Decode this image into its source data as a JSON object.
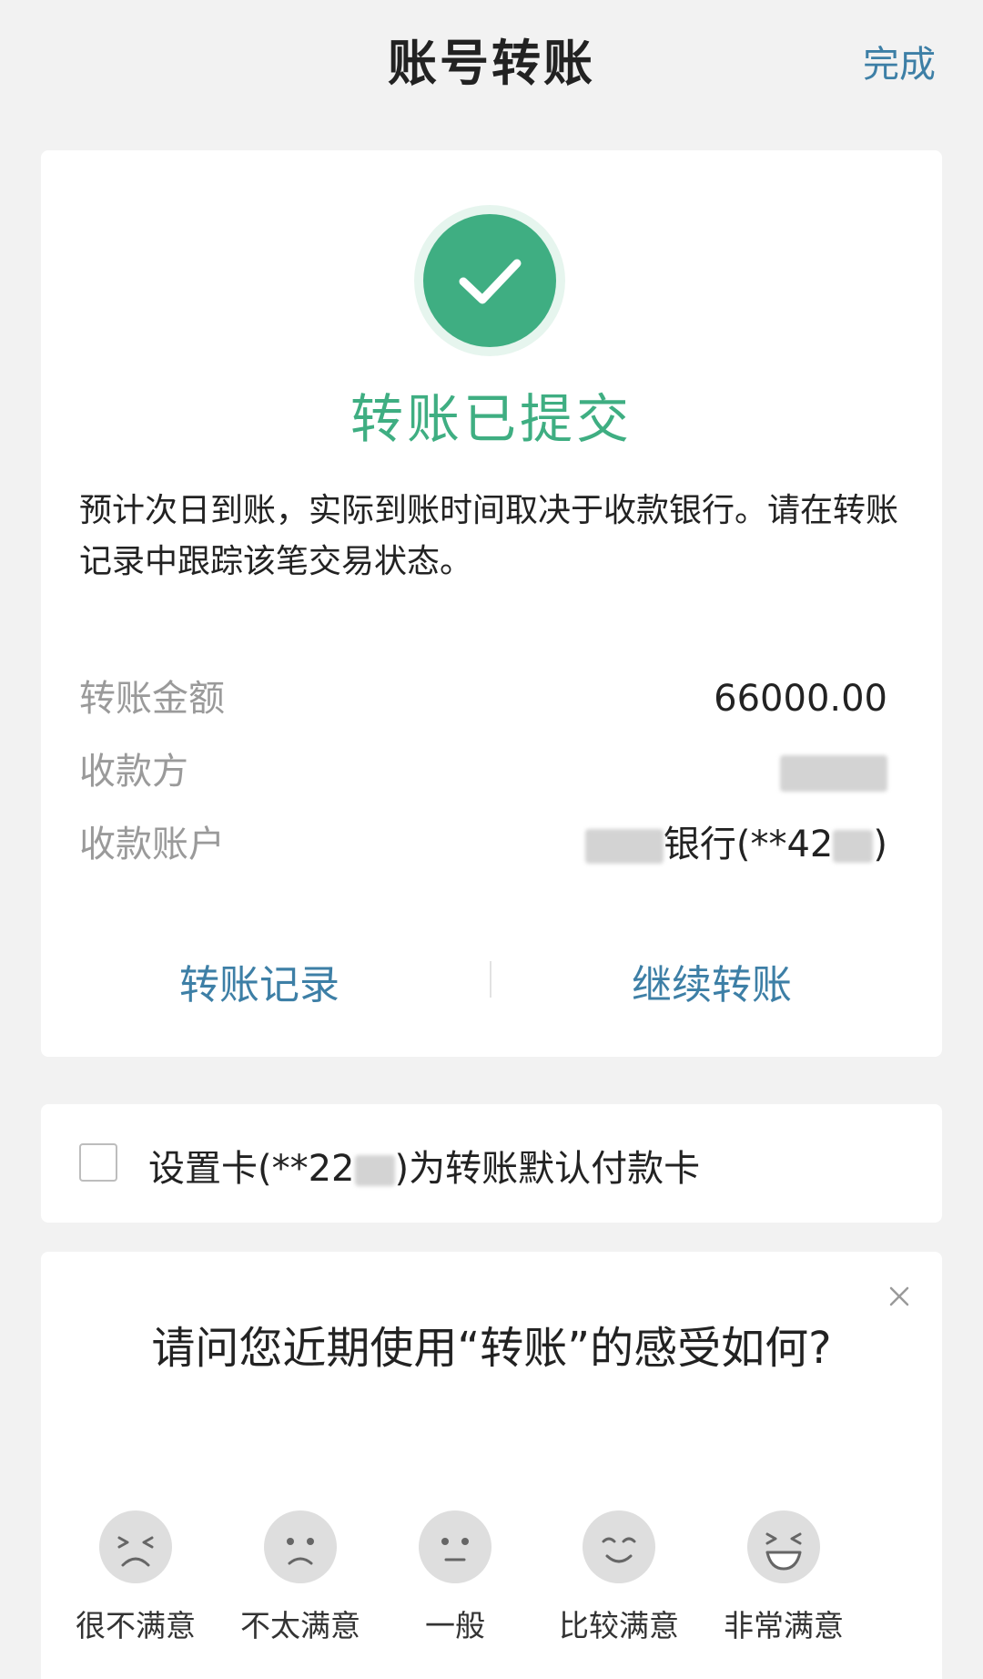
{
  "header": {
    "title": "账号转账",
    "done_label": "完成"
  },
  "result": {
    "status": "转账已提交",
    "description": "预计次日到账，实际到账时间取决于收款银行。请在转账记录中跟踪该笔交易状态。",
    "rows": [
      {
        "label": "转账金额",
        "value": "66000.00"
      },
      {
        "label": "收款方",
        "value": ""
      },
      {
        "label": "收款账户",
        "value_bank": "银行(**42",
        "value_tail": ")"
      }
    ],
    "actions": {
      "records": "转账记录",
      "continue": "继续转账"
    }
  },
  "default_card": {
    "prefix": "设置卡(**22",
    "suffix": ")为转账默认付款卡",
    "checked": false
  },
  "survey": {
    "question": "请问您近期使用“转账”的感受如何?",
    "options": [
      "很不满意",
      "不太满意",
      "一般",
      "比较满意",
      "非常满意"
    ]
  },
  "colors": {
    "accent_green": "#3fae82",
    "link_blue": "#3d7fa6"
  }
}
